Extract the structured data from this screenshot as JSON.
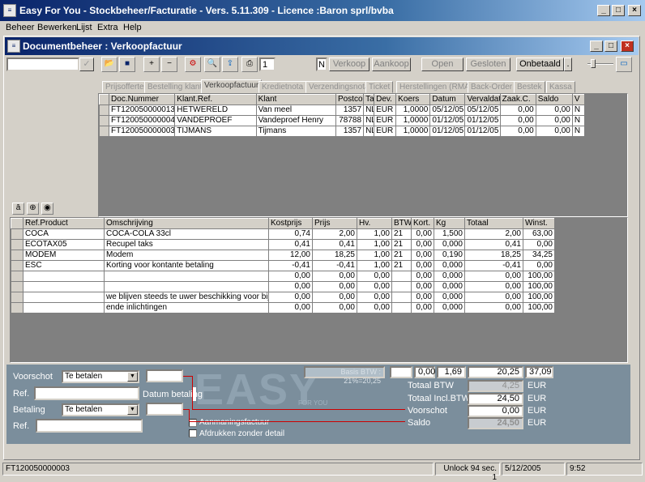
{
  "app": {
    "title": "Easy For You - Stockbeheer/Facturatie - Vers. 5.11.309 - Licence :Baron sprl/bvba"
  },
  "menu": [
    "Beheer",
    "Bewerken",
    "Lijst",
    "Extra",
    "Help"
  ],
  "doc": {
    "title": "Documentbeheer : Verkoopfactuur"
  },
  "toolbar": {
    "copies": "1",
    "n_box": "N",
    "verkoop": "Verkoop",
    "aankoop": "Aankoop",
    "open": "Open",
    "gesloten": "Gesloten",
    "onbetaald": "Onbetaald"
  },
  "tabs": [
    "Prijsofferte",
    "Bestelling klant",
    "Verkoopfactuur",
    "Kredietnota",
    "Verzendingsnota",
    "Ticket",
    "Herstellingen (RMA)",
    "Back-Order",
    "Bestek",
    "Kassa"
  ],
  "doc_table": {
    "headers": [
      "Doc.Nummer",
      "Klant.Ref.",
      "Klant",
      "Postco",
      "Ta",
      "Dev.",
      "Koers",
      "Datum",
      "Vervaldat",
      "Zaak.C.",
      "Saldo",
      "V"
    ],
    "rows": [
      [
        "FT120050000013",
        "HETWERELD",
        "Van meel",
        "1357",
        "NL",
        "EUR",
        "1,0000",
        "05/12/05",
        "05/12/05",
        "0,00",
        "0,00",
        "N"
      ],
      [
        "FT120050000004",
        "VANDEPROEF",
        "Vandeproef Henry",
        "78788",
        "NL",
        "EUR",
        "1,0000",
        "01/12/05",
        "01/12/05",
        "0,00",
        "0,00",
        "N"
      ],
      [
        "FT120050000003",
        "TIJMANS",
        "Tijmans",
        "1357",
        "NL",
        "EUR",
        "1,0000",
        "01/12/05",
        "01/12/05",
        "0,00",
        "0,00",
        "N"
      ]
    ]
  },
  "lines_table": {
    "headers": [
      "Ref.Product",
      "Omschrijving",
      "Kostprijs",
      "Prijs",
      "Hv.",
      "BTW",
      "Kort.",
      "Kg",
      "Totaal",
      "Winst."
    ],
    "rows": [
      [
        "COCA",
        "COCA-COLA 33cl",
        "0,74",
        "2,00",
        "1,00",
        "21",
        "0,00",
        "1,500",
        "2,00",
        "63,00"
      ],
      [
        "ECOTAX05",
        "Recupel taks",
        "0,41",
        "0,41",
        "1,00",
        "21",
        "0,00",
        "0,000",
        "0,41",
        "0,00"
      ],
      [
        "MODEM",
        "Modem",
        "12,00",
        "18,25",
        "1,00",
        "21",
        "0,00",
        "0,190",
        "18,25",
        "34,25"
      ],
      [
        "ESC",
        "Korting voor kontante betaling",
        "-0,41",
        "-0,41",
        "1,00",
        "21",
        "0,00",
        "0,000",
        "-0,41",
        "0,00"
      ],
      [
        "",
        "",
        "0,00",
        "0,00",
        "0,00",
        "",
        "0,00",
        "0,000",
        "0,00",
        "100,00"
      ],
      [
        "",
        "",
        "0,00",
        "0,00",
        "0,00",
        "",
        "0,00",
        "0,000",
        "0,00",
        "100,00"
      ],
      [
        "",
        "we blijven steeds te uwer beschikking voor bijkom",
        "0,00",
        "0,00",
        "0,00",
        "",
        "0,00",
        "0,000",
        "0,00",
        "100,00"
      ],
      [
        "",
        "ende inlichtingen",
        "0,00",
        "0,00",
        "0,00",
        "",
        "0,00",
        "0,000",
        "0,00",
        "100,00"
      ]
    ]
  },
  "footer": {
    "voorschot_label": "Voorschot",
    "voorschot_sel": "Te betalen",
    "ref_label": "Ref.",
    "datum_betaling": "Datum betaling",
    "betaling_label": "Betaling",
    "betaling_sel": "Te betalen",
    "ref2_label": "Ref.",
    "aanmaning": "Aanmaningsfactuur",
    "afdrukken": "Afdrukken zonder detail",
    "watermark": "EASY",
    "watermark_sub": "FOR YOU",
    "basis_btw": "Basis BTW : 21%=20,25",
    "sum_kort": "0,00",
    "sum_kg": "1,69",
    "sum_totaal": "20,25",
    "sum_winst": "37,09",
    "totaal_btw_label": "Totaal BTW",
    "totaal_btw": "4,25",
    "totaal_incl_label": "Totaal Incl.BTW",
    "totaal_incl": "24,50",
    "voorschot2_label": "Voorschot",
    "voorschot2": "0,00",
    "saldo_label": "Saldo",
    "saldo": "24,50",
    "cur": "EUR"
  },
  "status": {
    "doc": "FT120050000003",
    "unlock": "Unlock 94 sec. 1",
    "date": "5/12/2005",
    "time": "9:52"
  }
}
